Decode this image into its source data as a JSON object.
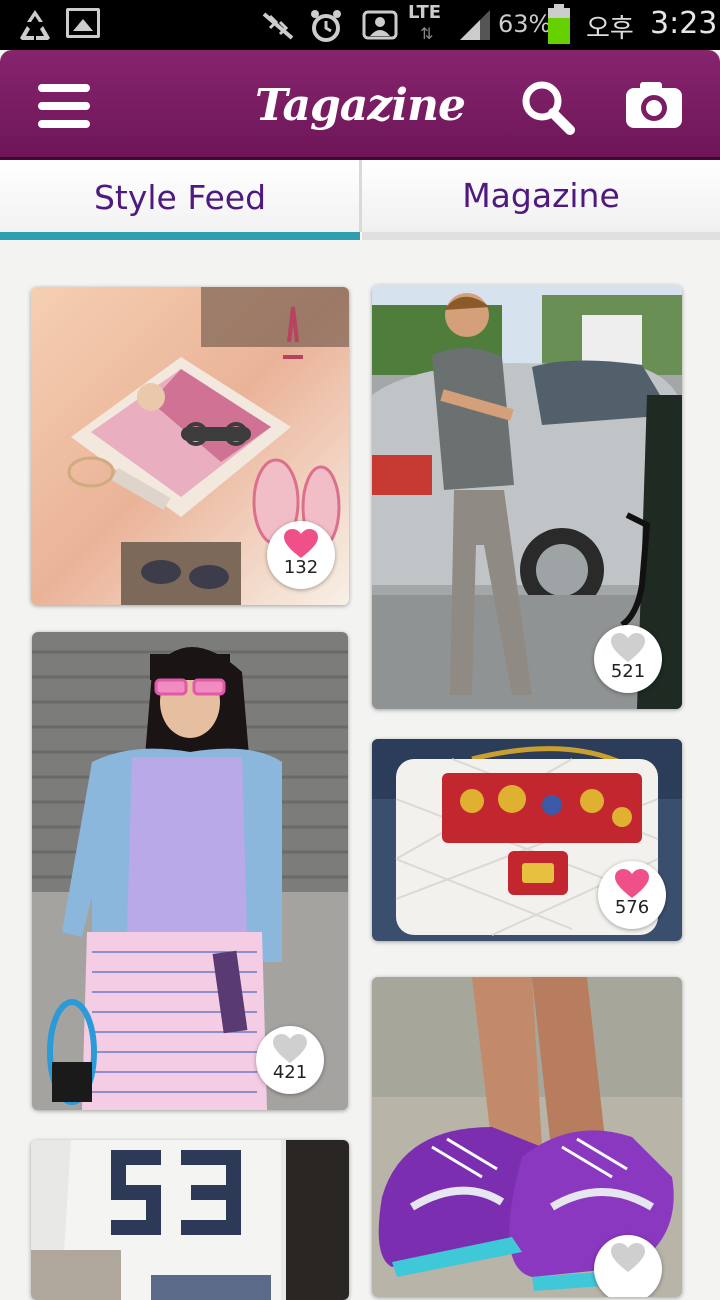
{
  "status_bar": {
    "network": "LTE",
    "battery_percent": "63%",
    "ampm": "오후",
    "time": "3:23"
  },
  "app_bar": {
    "title": "Tagazine"
  },
  "tabs": [
    {
      "label": "Style Feed",
      "selected": true
    },
    {
      "label": "Magazine",
      "selected": false
    }
  ],
  "feed": [
    {
      "likes": "132",
      "liked": true
    },
    {
      "likes": "521",
      "liked": false
    },
    {
      "likes": "421",
      "liked": false
    },
    {
      "likes": "576",
      "liked": true
    },
    {
      "likes": "",
      "liked": false
    },
    {
      "likes": "",
      "liked": false
    }
  ],
  "colors": {
    "brand": "#7a1d64",
    "tab_text": "#4e1a80",
    "tab_indicator": "#2f9fb0",
    "heart_liked": "#f0508a",
    "heart_unliked": "#cfcfcf"
  }
}
